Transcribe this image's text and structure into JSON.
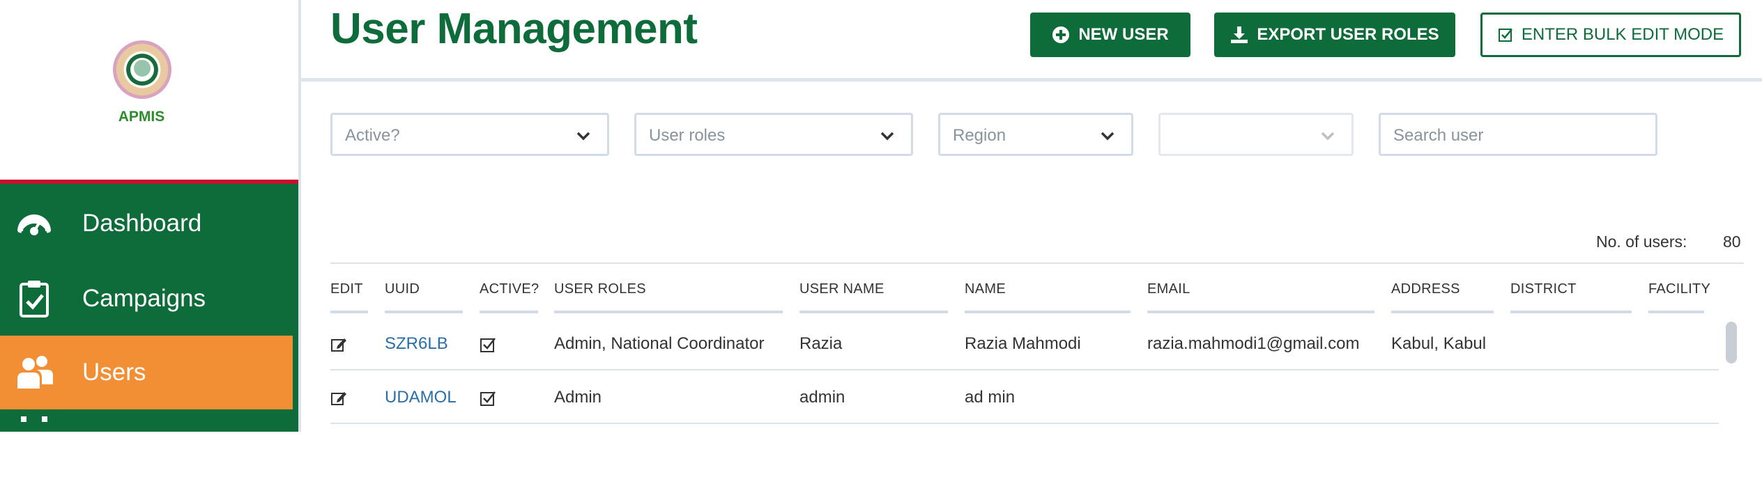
{
  "app": {
    "logo_text": "APMIS"
  },
  "colors": {
    "brand_green": "#0e6b3a",
    "active_orange": "#f28f35",
    "accent_red": "#c8102e",
    "link_blue": "#2a6ea6"
  },
  "sidebar": {
    "items": [
      {
        "label": "Dashboard",
        "icon": "speedometer-icon"
      },
      {
        "label": "Campaigns",
        "icon": "clipboard-check-icon"
      },
      {
        "label": "Users",
        "icon": "users-icon",
        "active": true
      }
    ]
  },
  "header": {
    "title": "User Management",
    "new_user_label": "NEW USER",
    "export_label": "EXPORT USER ROLES",
    "bulk_edit_label": "ENTER BULK EDIT MODE"
  },
  "filters": {
    "active_placeholder": "Active?",
    "roles_placeholder": "User roles",
    "region_placeholder": "Region",
    "district_placeholder": "",
    "search_placeholder": "Search user"
  },
  "summary": {
    "count_label": "No. of users:",
    "count_value": "80"
  },
  "table": {
    "headers": [
      "EDIT",
      "UUID",
      "ACTIVE?",
      "USER ROLES",
      "USER NAME",
      "NAME",
      "EMAIL",
      "ADDRESS",
      "DISTRICT",
      "FACILITY"
    ],
    "rows": [
      {
        "uuid": "SZR6LB",
        "active": true,
        "roles": "Admin, National Coordinator",
        "username": "Razia",
        "name": "Razia Mahmodi",
        "email": "razia.mahmodi1@gmail.com",
        "address": "Kabul, Kabul",
        "district": "",
        "facility": ""
      },
      {
        "uuid": "UDAMOL",
        "active": true,
        "roles": "Admin",
        "username": "admin",
        "name": "ad min",
        "email": "",
        "address": "",
        "district": "",
        "facility": ""
      }
    ]
  }
}
